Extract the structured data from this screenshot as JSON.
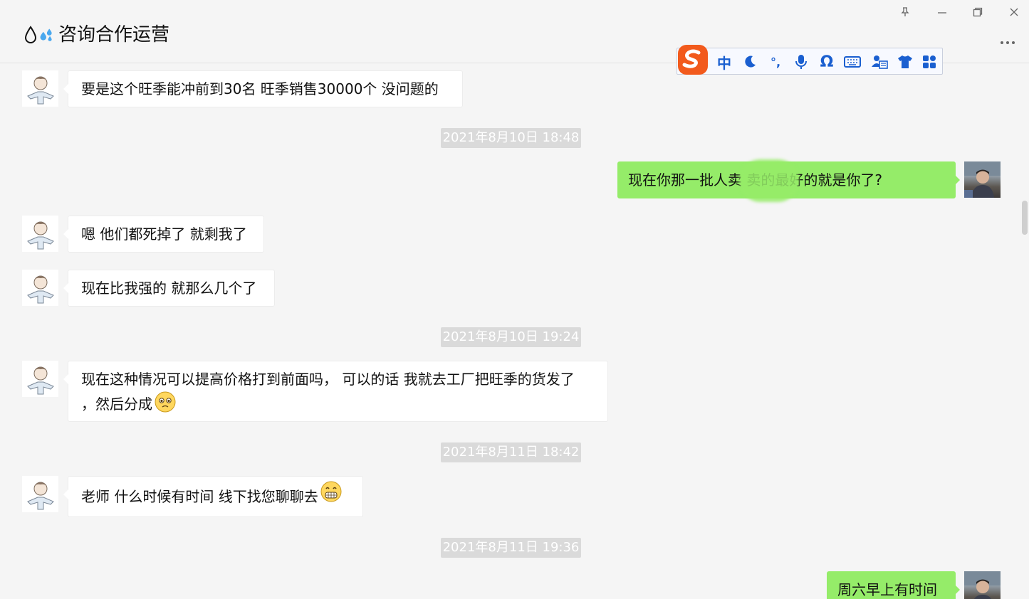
{
  "header": {
    "title": "咨询合作运营",
    "title_icons": [
      "droplet-icon",
      "sweat-droplets-icon"
    ]
  },
  "window_controls": [
    "pin-icon",
    "minimize-icon",
    "restore-icon",
    "close-icon"
  ],
  "ime_toolbar": {
    "logo": "sogou-s-icon",
    "items": [
      {
        "name": "chinese-mode",
        "label": "中"
      },
      {
        "name": "moon-icon",
        "label": ""
      },
      {
        "name": "punctuation-icon",
        "label": "°,"
      },
      {
        "name": "mic-icon",
        "label": ""
      },
      {
        "name": "omega-icon",
        "label": "Ω"
      },
      {
        "name": "keyboard-icon",
        "label": ""
      },
      {
        "name": "user-card-icon",
        "label": ""
      },
      {
        "name": "shirt-icon",
        "label": ""
      },
      {
        "name": "apps-icon",
        "label": ""
      }
    ]
  },
  "messages": [
    {
      "type": "msg",
      "side": "left",
      "text": "要是这个旺季能冲前到30名  旺季销售30000个 没问题的"
    },
    {
      "type": "time",
      "text": "2021年8月10日 18:48"
    },
    {
      "type": "msg",
      "side": "right",
      "text": "现在你那一批人卖          卖的最好的就是你了?"
    },
    {
      "type": "msg",
      "side": "left",
      "text": "嗯 他们都死掉了 就剩我了"
    },
    {
      "type": "msg",
      "side": "left",
      "text": "现在比我强的 就那么几个了"
    },
    {
      "type": "time",
      "text": "2021年8月10日 19:24"
    },
    {
      "type": "msg",
      "side": "left",
      "text_line1": "现在这种情况可以提高价格打到前面吗，  可以的话 我就去工厂把旺季的货发了",
      "text_line2": "，然后分成",
      "emoji": "pleading-face-icon"
    },
    {
      "type": "time",
      "text": "2021年8月11日 18:42"
    },
    {
      "type": "msg",
      "side": "left",
      "text": "老师 什么时候有时间 线下找您聊聊去",
      "emoji": "grinning-face-icon"
    },
    {
      "type": "time",
      "text": "2021年8月11日 19:36"
    },
    {
      "type": "msg",
      "side": "right",
      "text": "周六早上有时间"
    }
  ],
  "colors": {
    "self_bubble": "#95ec69",
    "other_bubble": "#ffffff",
    "background": "#f5f5f5",
    "timestamp_bg": "#dadada",
    "ime_blue": "#1a5fd0",
    "sogou_orange": "#f25a1c"
  }
}
